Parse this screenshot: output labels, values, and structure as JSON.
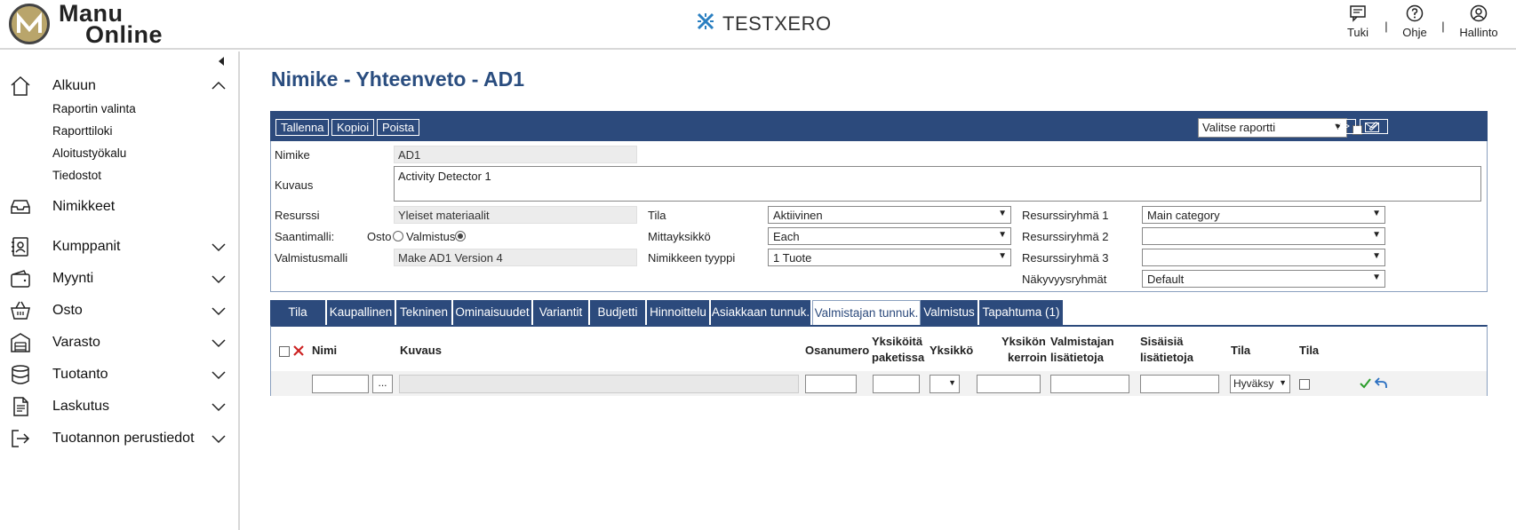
{
  "header": {
    "logo_line1": "Manu",
    "logo_line2": "Online",
    "brand": "TESTXERO",
    "actions": [
      {
        "label": "Tuki",
        "icon": "chat-icon"
      },
      {
        "label": "Ohje",
        "icon": "help-icon"
      },
      {
        "label": "Hallinto",
        "icon": "user-icon"
      }
    ],
    "separator": "|"
  },
  "sidebar": {
    "home": {
      "label": "Alkuun",
      "icon": "home-icon"
    },
    "sub_items": [
      "Raportin valinta",
      "Raporttiloki",
      "Aloitustyökalu",
      "Tiedostot"
    ],
    "items": [
      {
        "label": "Nimikkeet",
        "icon": "inbox-icon"
      },
      {
        "label": "Kumppanit",
        "icon": "contacts-icon"
      },
      {
        "label": "Myynti",
        "icon": "wallet-icon"
      },
      {
        "label": "Osto",
        "icon": "basket-icon"
      },
      {
        "label": "Varasto",
        "icon": "warehouse-icon"
      },
      {
        "label": "Tuotanto",
        "icon": "database-icon"
      },
      {
        "label": "Laskutus",
        "icon": "document-icon"
      },
      {
        "label": "Tuotannon perustiedot",
        "icon": "exit-icon"
      }
    ]
  },
  "page": {
    "title": "Nimike - Yhteenveto - AD1",
    "toolbar": {
      "save": "Tallenna",
      "copy": "Kopioi",
      "delete": "Poista",
      "report_select": "Valitse raportti",
      "prev": "<<",
      "next": ">>"
    },
    "form": {
      "nimike_label": "Nimike",
      "nimike_value": "AD1",
      "kuvaus_label": "Kuvaus",
      "kuvaus_value": "Activity Detector 1",
      "resurssi_label": "Resurssi",
      "resurssi_value": "Yleiset materiaalit",
      "saantimalli_label": "Saantimalli:",
      "osto_label": "Osto",
      "valmistus_label": "Valmistus",
      "valmistusmalli_label": "Valmistusmalli",
      "valmistusmalli_value": "Make AD1 Version 4",
      "tila_label": "Tila",
      "tila_value": "Aktiivinen",
      "mittayksikko_label": "Mittayksikkö",
      "mittayksikko_value": "Each",
      "tyyppi_label": "Nimikkeen tyyppi",
      "tyyppi_value": "1 Tuote",
      "rr1_label": "Resurssiryhmä 1",
      "rr1_value": "Main category",
      "rr2_label": "Resurssiryhmä 2",
      "rr2_value": "",
      "rr3_label": "Resurssiryhmä 3",
      "rr3_value": "",
      "nak_label": "Näkyvyysryhmät",
      "nak_value": "Default"
    },
    "tabs": [
      "Tila",
      "Kaupallinen",
      "Tekninen",
      "Ominaisuudet",
      "Variantit",
      "Budjetti",
      "Hinnoittelu",
      "Asiakkaan tunnuk.",
      "Valmistajan tunnuk.",
      "Valmistus",
      "Tapahtuma (1)"
    ],
    "active_tab": "Valmistajan tunnuk.",
    "grid": {
      "headers": {
        "nimi": "Nimi",
        "kuvaus": "Kuvaus",
        "osanumero": "Osanumero",
        "yks_paketissa_1": "Yksiköitä",
        "yks_paketissa_2": "paketissa",
        "yksikko": "Yksikkö",
        "kerroin_1": "Yksikön",
        "kerroin_2": "kerroin",
        "valm_lisa_1": "Valmistajan",
        "valm_lisa_2": "lisätietoja",
        "sis_lisa_1": "Sisäisiä",
        "sis_lisa_2": "lisätietoja",
        "tila1": "Tila",
        "tila2": "Tila"
      },
      "browse_button": "...",
      "status_select": "Hyväksy"
    },
    "colors": {
      "accent": "#2c4a7c",
      "title": "#2a4d7f",
      "ok": "#2a9d2a",
      "delete": "#cc2222"
    }
  }
}
